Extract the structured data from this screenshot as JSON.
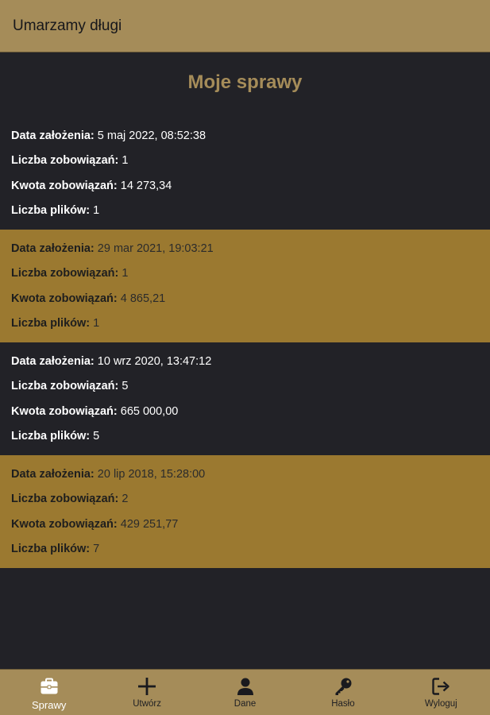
{
  "appbar": {
    "title": "Umarzamy długi"
  },
  "page": {
    "title": "Moje sprawy"
  },
  "labels": {
    "created": "Data założenia:",
    "obligations_count": "Liczba zobowiązań:",
    "obligations_amount": "Kwota zobowiązań:",
    "files_count": "Liczba plików:"
  },
  "cases": [
    {
      "created": "5 maj 2022, 08:52:38",
      "obligations_count": "1",
      "obligations_amount": "14 273,34",
      "files_count": "1"
    },
    {
      "created": "29 mar 2021, 19:03:21",
      "obligations_count": "1",
      "obligations_amount": "4 865,21",
      "files_count": "1"
    },
    {
      "created": "10 wrz 2020, 13:47:12",
      "obligations_count": "5",
      "obligations_amount": "665 000,00",
      "files_count": "5"
    },
    {
      "created": "20 lip 2018, 15:28:00",
      "obligations_count": "2",
      "obligations_amount": "429 251,77",
      "files_count": "7"
    }
  ],
  "bottom_nav": {
    "items": [
      {
        "label": "Sprawy",
        "icon": "briefcase-icon",
        "active": true
      },
      {
        "label": "Utwórz",
        "icon": "plus-icon"
      },
      {
        "label": "Dane",
        "icon": "person-icon"
      },
      {
        "label": "Hasło",
        "icon": "key-icon"
      },
      {
        "label": "Wyloguj",
        "icon": "logout-icon"
      }
    ]
  },
  "colors": {
    "accent": "#a58c59",
    "background": "#222227",
    "case_highlight": "#9b7930"
  }
}
